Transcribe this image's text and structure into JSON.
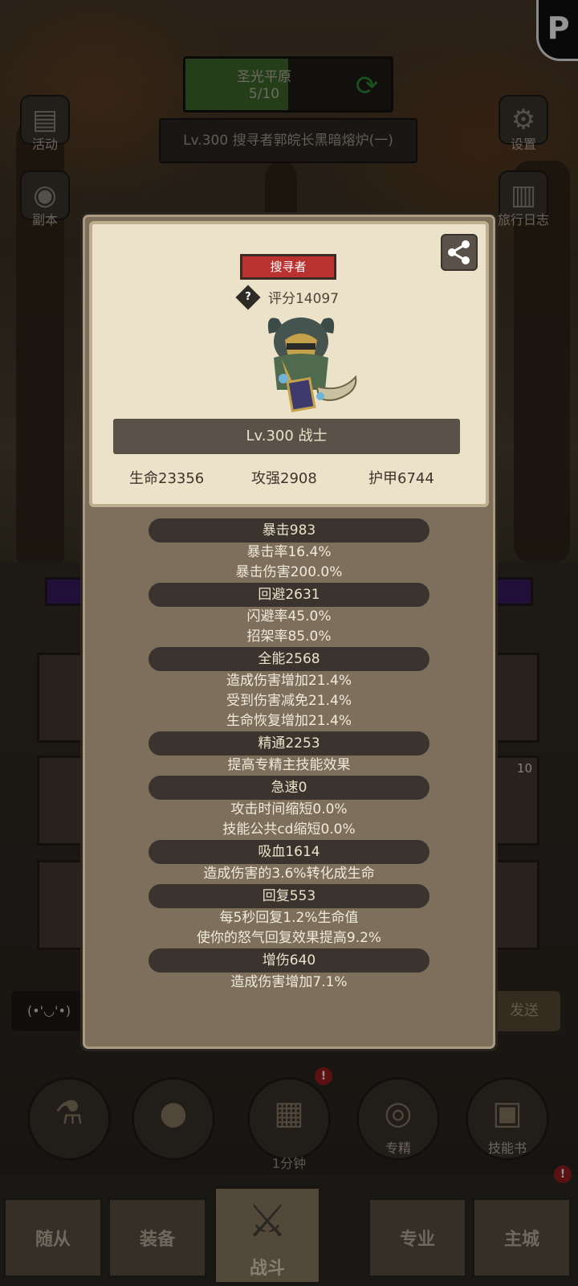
{
  "map": {
    "name": "圣光平原",
    "progress": "5/10",
    "fill_fraction": 0.5
  },
  "boss": {
    "label": "Lv.300 搜寻者郭皖长黑暗熔炉(一)"
  },
  "side_buttons": {
    "activity": "活动",
    "dungeon": "副本",
    "settings": "设置",
    "travel_log": "旅行日志"
  },
  "modal": {
    "class_tag": "搜寻者",
    "score": "评分14097",
    "level": "Lv.300 战士",
    "base_stats": {
      "hp": "生命23356",
      "attack": "攻强2908",
      "armor": "护甲6744"
    },
    "stat_groups": [
      {
        "head": "暴击983",
        "lines": [
          "暴击率16.4%",
          "暴击伤害200.0%"
        ]
      },
      {
        "head": "回避2631",
        "lines": [
          "闪避率45.0%",
          "招架率85.0%"
        ]
      },
      {
        "head": "全能2568",
        "lines": [
          "造成伤害增加21.4%",
          "受到伤害减免21.4%",
          "生命恢复增加21.4%"
        ]
      },
      {
        "head": "精通2253",
        "lines": [
          "提高专精主技能效果"
        ]
      },
      {
        "head": "急速0",
        "lines": [
          "攻击时间缩短0.0%",
          "技能公共cd缩短0.0%"
        ]
      },
      {
        "head": "吸血1614",
        "lines": [
          "造成伤害的3.6%转化成生命"
        ]
      },
      {
        "head": "回复553",
        "lines": [
          "每5秒回复1.2%生命值",
          "使你的怒气回复效果提高9.2%"
        ]
      },
      {
        "head": "增伤640",
        "lines": [
          "造成伤害增加7.1%"
        ]
      }
    ]
  },
  "chat": {
    "emoji": "(•'◡'•)",
    "send": "发送"
  },
  "slot_badge": "10",
  "actions": {
    "timer": "1分钟",
    "specialization": "专精",
    "skill_book": "技能书"
  },
  "nav": {
    "followers": "随从",
    "equipment": "装备",
    "battle": "战斗",
    "profession": "专业",
    "main_city": "主城"
  },
  "colors": {
    "class_tag_bg": "#b9322f",
    "map_fill": "#3f6b2b",
    "notification": "#9e1e1e"
  }
}
